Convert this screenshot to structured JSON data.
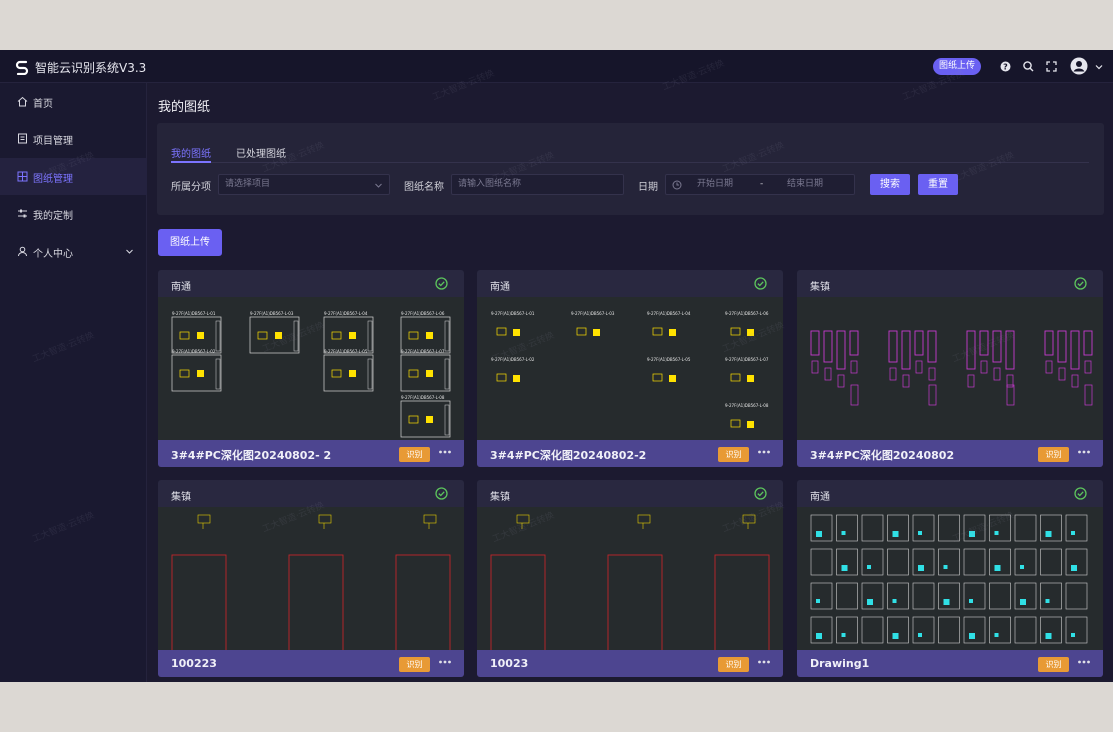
{
  "app": {
    "title": "智能云识别系统V3.3"
  },
  "header": {
    "upload_label": "图纸上传"
  },
  "sidebar": {
    "items": [
      {
        "label": "首页",
        "icon": "home-icon"
      },
      {
        "label": "项目管理",
        "icon": "document-icon"
      },
      {
        "label": "图纸管理",
        "icon": "grid-icon",
        "active": true
      },
      {
        "label": "我的定制",
        "icon": "sliders-icon"
      },
      {
        "label": "个人中心",
        "icon": "user-icon"
      }
    ]
  },
  "page": {
    "title": "我的图纸"
  },
  "tabs": [
    {
      "label": "我的图纸",
      "active": true
    },
    {
      "label": "已处理图纸"
    }
  ],
  "filters": {
    "project_label": "所属分项",
    "project_placeholder": "请选择项目",
    "name_label": "图纸名称",
    "name_placeholder": "请输入图纸名称",
    "date_label": "日期",
    "date_start": "开始日期",
    "date_sep": "-",
    "date_end": "结束日期",
    "search_label": "搜索",
    "reset_label": "重置"
  },
  "upload_label": "图纸上传",
  "cards": [
    {
      "location": "南通",
      "name": "3#4#PC深化图20240802- 2",
      "action": "识别",
      "thumb": "panels",
      "tags": [
        "9-27F(A1)DB567-L-01",
        "9-27F(A1)DB567-L-03",
        "9-27F(A1)DB567-L-04",
        "9-27F(A1)DB567-L-06",
        "9-27F(A1)DB567-L-02",
        "9-27F(A1)DB567-L-05",
        "9-27F(A1)DB567-L-07",
        "9-27F(A1)DB567-L-08"
      ]
    },
    {
      "location": "南通",
      "name": "3#4#PC深化图20240802-2",
      "action": "识别",
      "thumb": "sparse",
      "tags": [
        "9-27F(A1)DB567-L-01",
        "9-27F(A1)DB567-L-03",
        "9-27F(A1)DB567-L-04",
        "9-27F(A1)DB567-L-06",
        "9-27F(A1)DB567-L-02",
        "9-27F(A1)DB567-L-05",
        "9-27F(A1)DB567-L-07",
        "9-27F(A1)DB567-L-08"
      ]
    },
    {
      "location": "集镇",
      "name": "3#4#PC深化图20240802",
      "action": "识别",
      "thumb": "magenta"
    },
    {
      "location": "集镇",
      "name": "100223",
      "action": "识别",
      "thumb": "red"
    },
    {
      "location": "集镇",
      "name": "10023",
      "action": "识别",
      "thumb": "red"
    },
    {
      "location": "南通",
      "name": "Drawing1",
      "action": "识别",
      "thumb": "cyan"
    }
  ],
  "watermark": "工大智造·云转换",
  "colors": {
    "accent": "#6a60f2",
    "action": "#e89a35",
    "success": "#5cc45c",
    "footer": "#4d4590"
  }
}
